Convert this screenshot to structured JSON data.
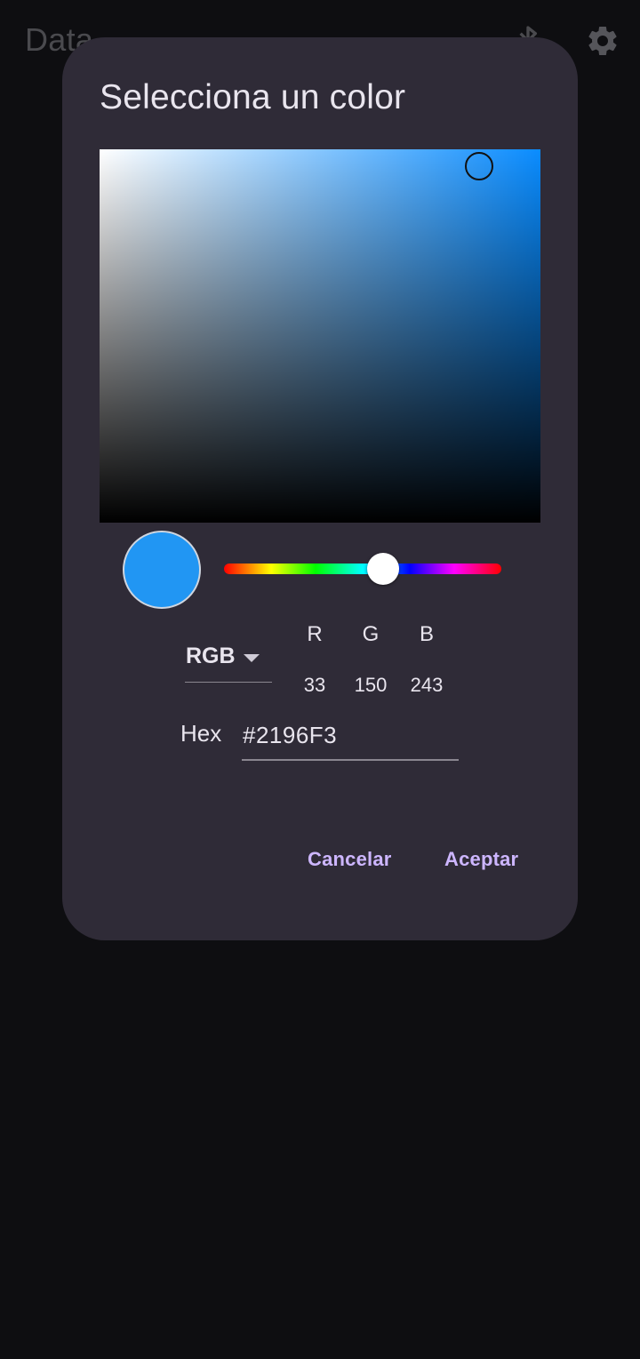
{
  "background": {
    "app_title": "Data",
    "icons": {
      "bluetooth": "bluetooth-icon",
      "settings": "gear-icon"
    }
  },
  "dialog": {
    "title": "Selecciona un color",
    "selected_color": "#2196F3",
    "hue_position": 0.57,
    "mode": "RGB",
    "channels": [
      {
        "label": "R",
        "value": "33"
      },
      {
        "label": "G",
        "value": "150"
      },
      {
        "label": "B",
        "value": "243"
      }
    ],
    "hex_label": "Hex",
    "hex_value": "#2196F3",
    "cancel_label": "Cancelar",
    "accept_label": "Aceptar"
  },
  "colors": {
    "dialog_bg": "#2f2b37",
    "accent_text": "#cdb6ff",
    "screen_bg": "#0e0e11"
  }
}
